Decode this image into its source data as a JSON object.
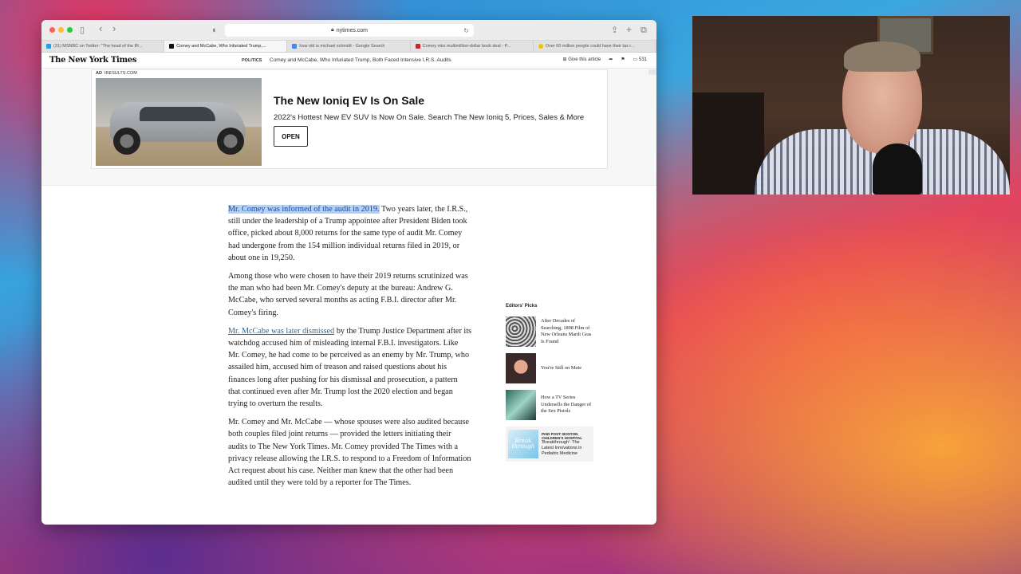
{
  "browser": {
    "url": "nytimes.com",
    "tabs": [
      {
        "label": "(31) MSNBC on Twitter: \"The head of the IR...",
        "fav_color": "#1da1f2",
        "active": false
      },
      {
        "label": "Comey and McCabe, Who Infuriated Trump,...",
        "fav_color": "#111111",
        "active": true
      },
      {
        "label": "how old is michael schmidt - Google Search",
        "fav_color": "#4285f4",
        "active": false
      },
      {
        "label": "Comey inks multimillion-dollar book deal - P...",
        "fav_color": "#d6222a",
        "active": false
      },
      {
        "label": "Over 60 million people could have their tax r...",
        "fav_color": "#f5c400",
        "active": false
      }
    ]
  },
  "nyt": {
    "logo": "The New York Times",
    "section": "POLITICS",
    "headline": "Comey and McCabe, Who Infuriated Trump, Both Faced Intensive I.R.S. Audits",
    "give_article": "Give this article",
    "comment_count": "531"
  },
  "ad": {
    "badge": "AD",
    "domain": "IRESULTS.COM",
    "title": "The New Ioniq EV Is On Sale",
    "subtitle": "2022's Hottest New EV SUV Is Now On Sale. Search The New Ioniq 5, Prices, Sales & More",
    "button": "OPEN"
  },
  "article": {
    "p1_highlight": "Mr. Comey was informed of the audit in 2019.",
    "p1_rest": " Two years later, the I.R.S., still under the leadership of a Trump appointee after President Biden took office, picked about 8,000 returns for the same type of audit Mr. Comey had undergone from the 154 million individual returns filed in 2019, or about one in 19,250.",
    "p2": "Among those who were chosen to have their 2019 returns scrutinized was the man who had been Mr. Comey's deputy at the bureau: Andrew G. McCabe, who served several months as acting F.B.I. director after Mr. Comey's firing.",
    "p3_link": "Mr. McCabe was later dismissed",
    "p3_rest": " by the Trump Justice Department after its watchdog accused him of misleading internal F.B.I. investigators. Like Mr. Comey, he had come to be perceived as an enemy by Mr. Trump, who assailed him, accused him of treason and raised questions about his finances long after pushing for his dismissal and prosecution, a pattern that continued even after Mr. Trump lost the 2020 election and began trying to overturn the results.",
    "p4": "Mr. Comey and Mr. McCabe — whose spouses were also audited because both couples filed joint returns — provided the letters initiating their audits to The New York Times. Mr. Comey provided The Times with a privacy release allowing the I.R.S. to respond to a Freedom of Information Act request about his case. Neither man knew that the other had been audited until they were told by a reporter for The Times."
  },
  "sidebar": {
    "title": "Editors' Picks",
    "picks": [
      {
        "text": "After Decades of Searching, 1898 Film of New Orleans Mardi Gras Is Found"
      },
      {
        "text": "You're Still on Mute"
      },
      {
        "text": "How a TV Series Undersells the Danger of the Sex Pistols"
      }
    ],
    "paid": {
      "label": "PAID POST: BOSTON CHILDREN'S HOSPITAL",
      "text": "'Breakthrough': The Latest Innovations in Pediatric Medicine",
      "thumb_text": "Break through"
    }
  },
  "icons": {
    "sidebar_toggle": "▯",
    "back": "‹",
    "forward": "›",
    "shield": "◐",
    "reload": "↻",
    "share": "⇪",
    "new_tab": "+",
    "tabs_overview": "⧉",
    "gift": "⊞",
    "share_arrow": "➦",
    "bookmark": "⚑",
    "comment": "▭"
  }
}
